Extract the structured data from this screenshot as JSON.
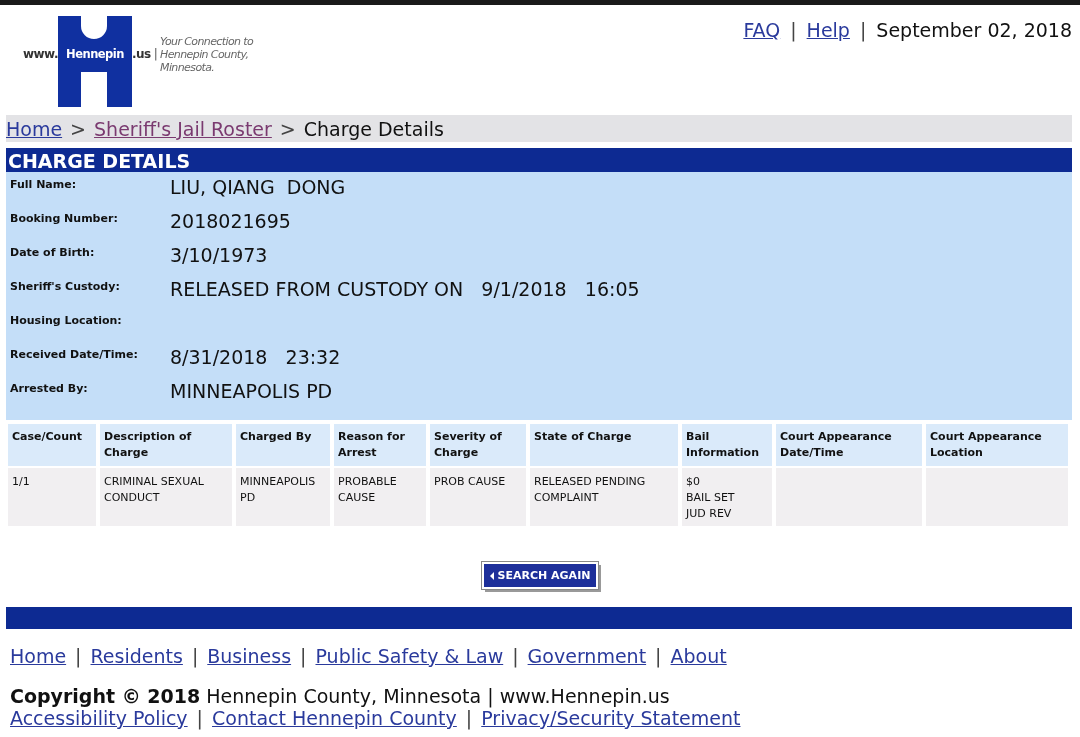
{
  "header": {
    "logo": {
      "prefix": "www.",
      "name": "Hennepin",
      "suffix": ".us",
      "divider": "|",
      "tagline": [
        "Your Connection to",
        "Hennepin County,",
        "Minnesota."
      ]
    },
    "top_links": [
      {
        "label": "FAQ"
      },
      {
        "label": "Help"
      }
    ],
    "separator": "|",
    "date": "September 02, 2018"
  },
  "breadcrumb": {
    "separator": ">",
    "items": [
      {
        "label": "Home",
        "kind": "link"
      },
      {
        "label": "Sheriff's Jail Roster",
        "kind": "visited"
      },
      {
        "label": "Charge Details",
        "kind": "current"
      }
    ]
  },
  "section_title": "CHARGE DETAILS",
  "details": [
    {
      "label": "Full Name:",
      "value": "LIU, QIANG  DONG"
    },
    {
      "label": "Booking Number:",
      "value": "2018021695"
    },
    {
      "label": "Date of Birth:",
      "value": "3/10/1973"
    },
    {
      "label": "Sheriff's Custody:",
      "value": "RELEASED FROM CUSTODY ON   9/1/2018   16:05"
    },
    {
      "label": "Housing Location:"
    },
    {
      "label": "Received Date/Time:",
      "value": "8/31/2018   23:32"
    },
    {
      "label": "Arrested By:",
      "value": "MINNEAPOLIS PD"
    }
  ],
  "table": {
    "columns": [
      "Case/Count",
      "Description of Charge",
      "Charged By",
      "Reason for Arrest",
      "Severity of Charge",
      "State of Charge",
      "Bail Information",
      "Court Appearance Date/Time",
      "Court Appearance Location"
    ],
    "rows": [
      [
        "1/1",
        "CRIMINAL SEXUAL CONDUCT",
        "MINNEAPOLIS PD",
        "PROBABLE CAUSE",
        "PROB CAUSE",
        "RELEASED PENDING COMPLAINT",
        "$0\nBAIL SET\nJUD REV",
        "",
        ""
      ]
    ]
  },
  "search_button": {
    "label": "SEARCH AGAIN"
  },
  "footer": {
    "separator": "|",
    "nav": [
      "Home",
      "Residents",
      "Business",
      "Public Safety & Law",
      "Government",
      "About"
    ],
    "copyright": "**Copyright © 2018** Hennepin County, Minnesota | www.Hennepin.us",
    "links": [
      "Accessibility Policy",
      "Contact Hennepin County",
      "Privacy/Security Statement"
    ]
  }
}
